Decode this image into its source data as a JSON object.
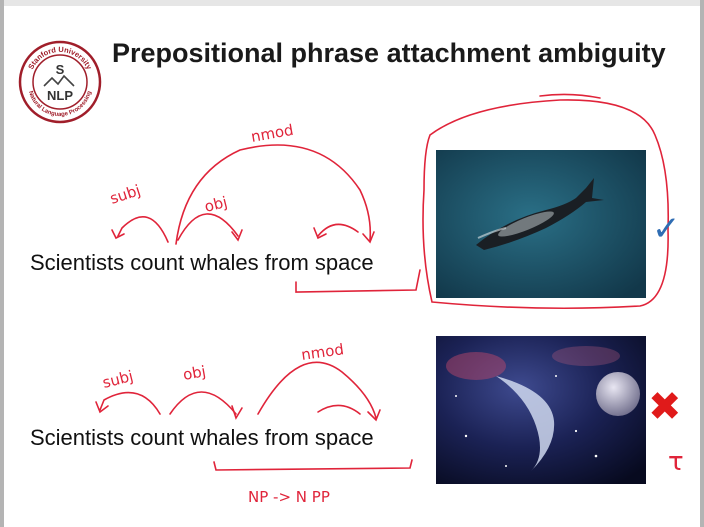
{
  "logo": {
    "top_text": "Stanford University",
    "bottom_text": "Natural Language Processing",
    "center_letter": "S",
    "center_word": "NLP"
  },
  "slide": {
    "title": "Prepositional phrase attachment ambiguity",
    "sentence_1": "Scientists count whales from space",
    "sentence_2": "Scientists count whales from space"
  },
  "annotations": {
    "subj_1": "subj",
    "obj_1": "obj",
    "nmod_1": "nmod",
    "subj_2": "subj",
    "obj_2": "obj",
    "nmod_2": "nmod",
    "rule": "NP -> N PP",
    "correct_mark": "✓",
    "wrong_mark": "✖",
    "stray_mark": "τ"
  },
  "colors": {
    "ink": "#e0243a",
    "check": "#2f6db3",
    "cross": "#e01a1a",
    "logo": "#a01e2a"
  }
}
